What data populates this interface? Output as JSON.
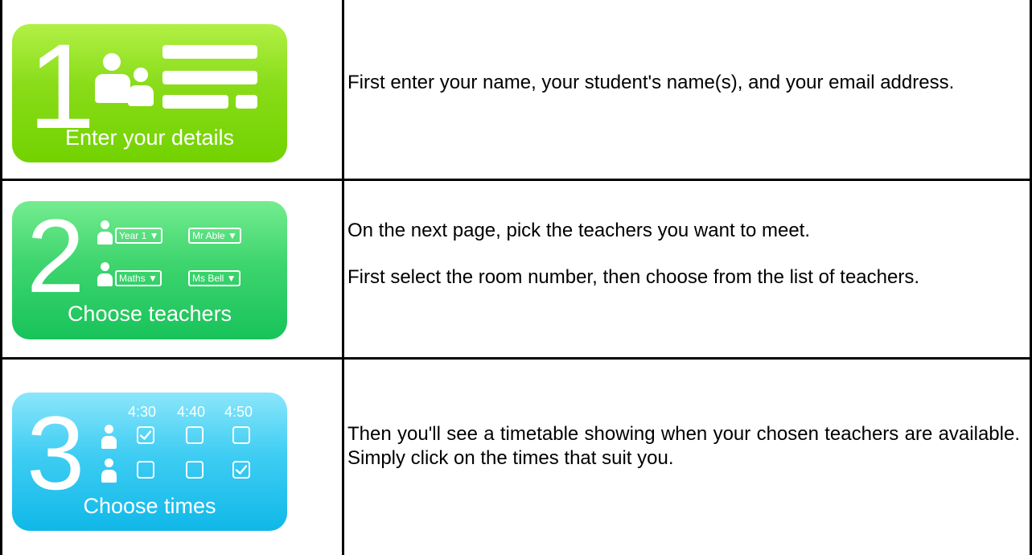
{
  "steps": [
    {
      "number": "1",
      "caption": "Enter your details",
      "description": [
        "First enter your name, your student's name(s), and your email address."
      ],
      "icon": "people-form-icon",
      "colors": {
        "top": "#b2f045",
        "bottom": "#73d200"
      }
    },
    {
      "number": "2",
      "caption": "Choose teachers",
      "rows": [
        {
          "select_1": "Year 1 ▼",
          "select_2": "Mr Able ▼"
        },
        {
          "select_1": "Maths ▼",
          "select_2": "Ms Bell ▼"
        }
      ],
      "description": [
        "On the next page, pick the teachers you want to meet.",
        "First select the room number, then choose from the list of teachers."
      ],
      "colors": {
        "top": "#74ec90",
        "bottom": "#18c25a"
      }
    },
    {
      "number": "3",
      "caption": "Choose times",
      "times": [
        "4:30",
        "4:40",
        "4:50"
      ],
      "checked": [
        [
          true,
          false,
          false
        ],
        [
          false,
          false,
          true
        ]
      ],
      "check_mark": "☑",
      "description": [
        "Then you'll see a timetable showing when your chosen teachers are available. Simply click on the times that suit you."
      ],
      "colors": {
        "top": "#8be6fb",
        "bottom": "#10b8e8"
      }
    }
  ]
}
